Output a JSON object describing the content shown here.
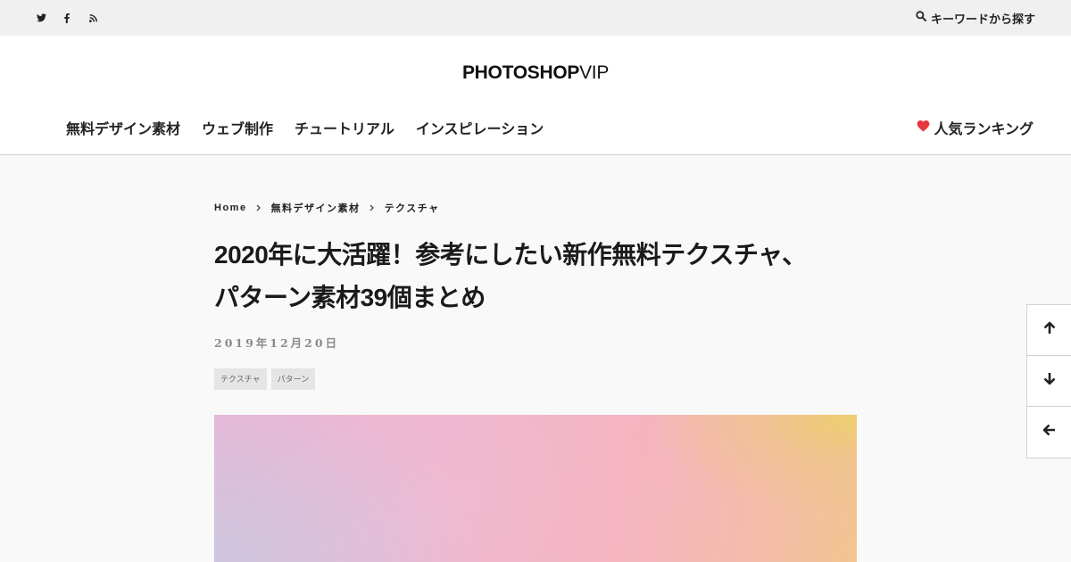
{
  "topbar": {
    "social": [
      {
        "name": "twitter-icon"
      },
      {
        "name": "facebook-icon"
      },
      {
        "name": "rss-icon"
      }
    ],
    "search_label": "キーワードから探す"
  },
  "header": {
    "logo_bold": "PHOTOSHOP",
    "logo_light": "VIP",
    "nav": [
      "無料デザイン素材",
      "ウェブ制作",
      "チュートリアル",
      "インスピレーション"
    ],
    "ranking_label": "人気ランキング"
  },
  "breadcrumb": [
    "Home",
    "無料デザイン素材",
    "テクスチャ"
  ],
  "article": {
    "title_line1": "2020年に大活躍！参考にしたい新作無料テクスチャ、",
    "title_line2": "パターン素材39個まとめ",
    "date": "2019年12月20日",
    "tags": [
      "テクスチャ",
      "パターン"
    ]
  },
  "side_controls": [
    {
      "icon": "arrow-up-icon"
    },
    {
      "icon": "arrow-down-icon"
    },
    {
      "icon": "arrow-left-icon"
    }
  ],
  "colors": {
    "accent_heart": "#e8383d",
    "topbar_bg": "#f0f0f0",
    "page_bg": "#f9f9f9",
    "tag_bg": "#e5e5e5"
  }
}
